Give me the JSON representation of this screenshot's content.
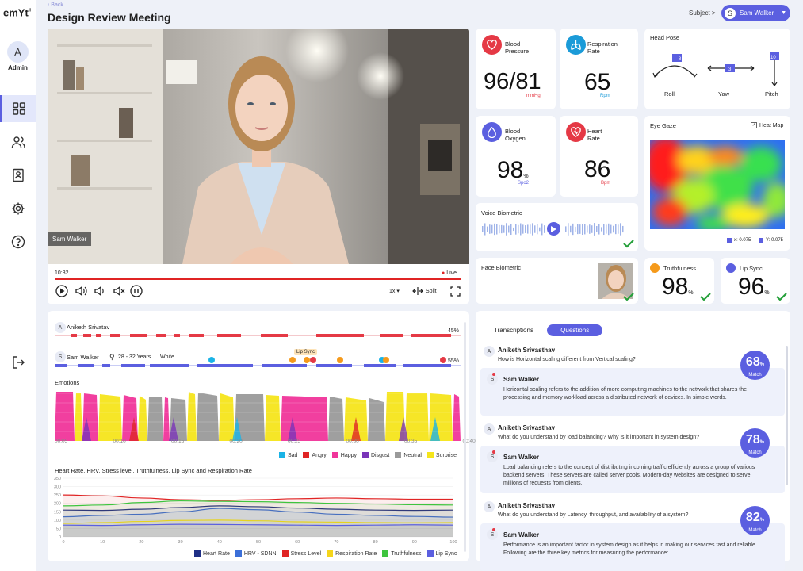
{
  "app": {
    "logo": "emYt",
    "logo_sup": "+",
    "user_initial": "A",
    "user_role": "Admin"
  },
  "header": {
    "back": "Back",
    "title": "Design Review Meeting",
    "subject_label": "Subject >",
    "subject_initial": "S",
    "subject_name": "Sam Walker"
  },
  "video": {
    "participant": "Sam Walker",
    "time": "10:32",
    "live": "Live",
    "speed": "1x",
    "split": "Split",
    "progress": 1.0
  },
  "metrics": {
    "blood_pressure": {
      "title1": "Blood",
      "title2": "Pressure",
      "value": "96/81",
      "unit": "mmHg",
      "color": "#e53945"
    },
    "respiration": {
      "title1": "Respiration",
      "title2": "Rate",
      "value": "65",
      "unit": "Rpm",
      "color": "#1b9bd8"
    },
    "oxygen": {
      "title1": "Blood",
      "title2": "Oxygen",
      "value": "98",
      "pct": "%",
      "unit": "Spo2",
      "color": "#5b5fe0"
    },
    "heart": {
      "title1": "Heart",
      "title2": "Rate",
      "value": "86",
      "unit": "Bpm",
      "color": "#e53945"
    },
    "truthfulness": {
      "title": "Truthfulness",
      "value": "98",
      "pct": "%"
    },
    "lipsync": {
      "title": "Lip Sync",
      "value": "96",
      "pct": "%"
    }
  },
  "head_pose": {
    "title": "Head Pose",
    "roll_label": "Roll",
    "roll_value": "8",
    "yaw_label": "Yaw",
    "yaw_value": "3",
    "pitch_label": "Pitch",
    "pitch_value": "10"
  },
  "eye_gaze": {
    "title": "Eye Gaze",
    "heatmap_label": "Heat Map",
    "x_label": "x: 0.075",
    "y_label": "Y: 0.075"
  },
  "voice": {
    "title": "Voice Biometric"
  },
  "face": {
    "title": "Face Biometric"
  },
  "timeline": {
    "speaker1": {
      "initial": "A",
      "name": "Aniketh Srivatav",
      "pct": "45%"
    },
    "speaker2": {
      "initial": "S",
      "name": "Sam Walker",
      "age": "28 - 32 Years",
      "ethnicity": "White",
      "pct": "55%"
    },
    "tooltip": "Lip Sync"
  },
  "chart_data": [
    {
      "type": "area",
      "title": "Emotions",
      "x_ticks": [
        "00:05",
        "00:10",
        "00:15",
        "00:20",
        "00:25",
        "00:30",
        "00:35",
        "00:40"
      ],
      "series": [
        {
          "name": "Sad",
          "color": "#1ab3e6"
        },
        {
          "name": "Angry",
          "color": "#e02424"
        },
        {
          "name": "Happy",
          "color": "#f0359a"
        },
        {
          "name": "Disgust",
          "color": "#7a34b8"
        },
        {
          "name": "Neutral",
          "color": "#9a9a9a"
        },
        {
          "name": "Surprise",
          "color": "#f5e51b"
        }
      ]
    },
    {
      "type": "line",
      "title": "Heart Rate, HRV, Stress level, Truthfulness, Lip Sync and Respiration Rate",
      "x": [
        0,
        10,
        20,
        30,
        40,
        50,
        60,
        70,
        80,
        90,
        100
      ],
      "ylim": [
        0,
        350
      ],
      "y_ticks": [
        0,
        50,
        100,
        150,
        200,
        250,
        300,
        350
      ],
      "series": [
        {
          "name": "Heart Rate",
          "color": "#1f2f86",
          "values": [
            160,
            158,
            165,
            175,
            185,
            180,
            172,
            165,
            160,
            158,
            160
          ]
        },
        {
          "name": "HRV - SDNN",
          "color": "#3b6fd8",
          "values": [
            120,
            128,
            135,
            150,
            170,
            162,
            148,
            135,
            128,
            122,
            118
          ]
        },
        {
          "name": "Stress Level",
          "color": "#e02424",
          "values": [
            250,
            245,
            232,
            222,
            218,
            222,
            228,
            232,
            228,
            225,
            225
          ]
        },
        {
          "name": "Respiration Rate",
          "color": "#f5d51b",
          "values": [
            80,
            85,
            92,
            98,
            100,
            96,
            90,
            88,
            85,
            84,
            85
          ]
        },
        {
          "name": "Truthfulness",
          "color": "#3ec43e",
          "values": [
            185,
            190,
            205,
            215,
            212,
            210,
            205,
            200,
            196,
            192,
            190
          ]
        },
        {
          "name": "Lip Sync",
          "color": "#5b5fe0",
          "values": [
            70,
            68,
            72,
            75,
            74,
            72,
            70,
            68,
            70,
            72,
            70
          ]
        }
      ]
    }
  ],
  "transcript": {
    "tab1": "Transcriptions",
    "tab2": "Questions",
    "items": [
      {
        "q_initial": "A",
        "q_name": "Aniketh Srivasthav",
        "question": "How is Horizontal scaling different from Vertical scaling?",
        "a_initial": "S",
        "a_name": "Sam Walker",
        "answer": "Horizontal scaling refers to the addition of more computing machines to the network that shares the processing and memory workload across a distributed network of devices. In simple words.",
        "match": "68",
        "match_label": "Match"
      },
      {
        "q_initial": "A",
        "q_name": "Aniketh Srivasthav",
        "question": "What do you understand by load balancing? Why is it important in system design?",
        "a_initial": "S",
        "a_name": "Sam Walker",
        "answer": "Load balancing refers to the concept of distributing incoming traffic efficiently across a group of various backend servers. These servers are called server pools. Modern-day websites are designed to serve millions of requests from clients.",
        "match": "78",
        "match_label": "Match"
      },
      {
        "q_initial": "A",
        "q_name": "Aniketh Srivasthav",
        "question": "What do you understand by Latency, throughput, and availability of a system?",
        "a_initial": "S",
        "a_name": "Sam Walker",
        "answer": "Performance is an important factor in system design as it helps in making our services fast and reliable. Following are the three key metrics for measuring the performance:",
        "match": "82",
        "match_label": "Match"
      }
    ]
  }
}
